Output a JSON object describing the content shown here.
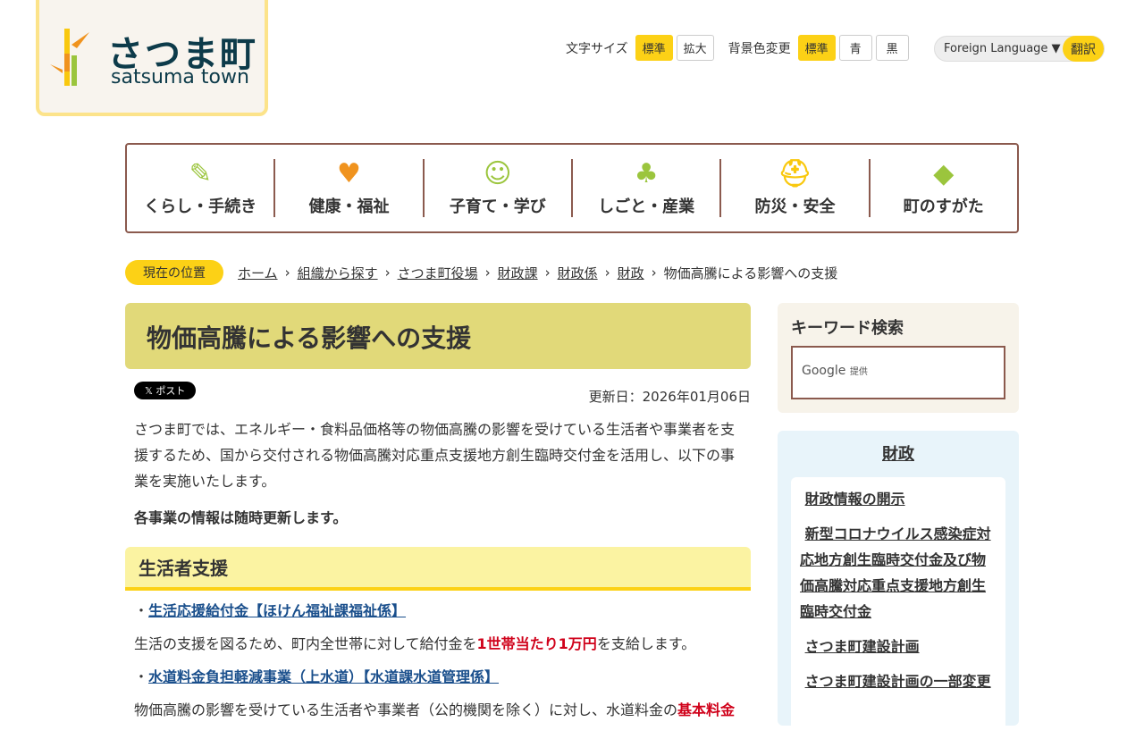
{
  "header": {
    "logo_jp": "さつま町",
    "logo_en": "satsuma town",
    "font_size_label": "文字サイズ",
    "font_standard": "標準",
    "font_large": "拡大",
    "bg_label": "背景色変更",
    "bg_standard": "標準",
    "bg_blue": "青",
    "bg_black": "黒",
    "lang_label": "Foreign Language ▼",
    "translate": "翻訳"
  },
  "nav": [
    {
      "label": "くらし・手続き",
      "icon": "✎"
    },
    {
      "label": "健康・福祉",
      "icon": "♥"
    },
    {
      "label": "子育て・学び",
      "icon": "☺"
    },
    {
      "label": "しごと・産業",
      "icon": "♣"
    },
    {
      "label": "防災・安全",
      "icon": "⛑"
    },
    {
      "label": "町のすがた",
      "icon": "◆"
    }
  ],
  "breadcrumb": {
    "here": "現在の位置",
    "items": [
      "ホーム",
      "組織から探す",
      "さつま町役場",
      "財政課",
      "財政係",
      "財政"
    ],
    "current": "物価高騰による影響への支援"
  },
  "main": {
    "title": "物価高騰による影響への支援",
    "post": "𝕏 ポスト",
    "updated": "更新日：2026年01月06日",
    "intro": "さつま町では、エネルギー・食料品価格等の物価高騰の影響を受けている生活者や事業者を支援するため、国から交付される物価高騰対応重点支援地方創生臨時交付金を活用し、以下の事業を実施いたします。",
    "note": "各事業の情報は随時更新します。",
    "section": "生活者支援",
    "item1": "生活応援給付金【ほけん福祉課福祉係】",
    "item1_a": "生活の支援を図るため、町内全世帯に対して給付金を",
    "item1_red": "1世帯当たり1万円",
    "item1_b": "を支給します。",
    "item2": "水道料金負担軽減事業（上水道）【水道課水道管理係】",
    "item2_a": "物価高騰の影響を受けている生活者や事業者（公的機関を除く）に対し、水道料金の",
    "item2_red": "基本料金"
  },
  "sidebar": {
    "search_title": "キーワード検索",
    "google": "Google",
    "provided": "提供",
    "cat_title": "財政",
    "links": [
      "財政情報の開示",
      "新型コロナウイルス感染症対応地方創生臨時交付金及び物価高騰対応重点支援地方創生臨時交付金",
      "さつま町建設計画",
      "さつま町建設計画の一部変更"
    ]
  }
}
